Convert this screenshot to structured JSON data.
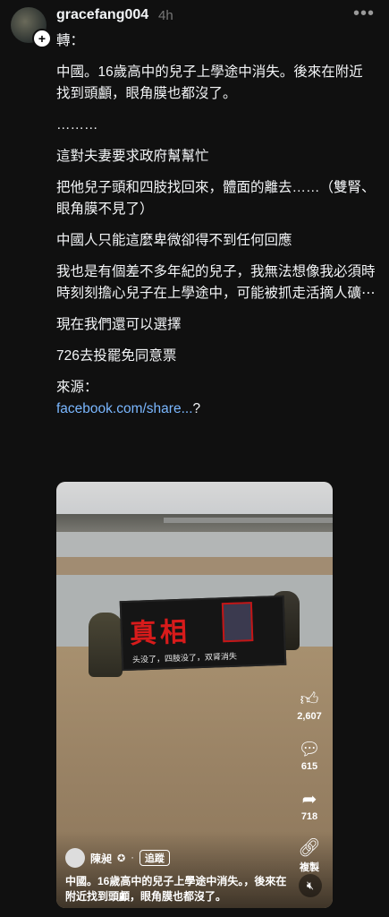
{
  "post": {
    "username": "gracefang004",
    "time": "4h",
    "more_icon": "more-dots-icon",
    "paragraphs": [
      "轉：",
      "中國。16歲高中的兒子上學途中消失。後來在附近找到頭顱，眼角膜也都沒了。",
      "………",
      "這對夫妻要求政府幫幫忙",
      "把他兒子頭和四肢找回來，體面的離去……（雙腎、眼角膜不見了）",
      "中國人只能這麼卑微卻得不到任何回應",
      "我也是有個差不多年紀的兒子，我無法想像我必須時時刻刻擔心兒子在上學途中，可能被抓走活摘人礦⋯",
      "現在我們還可以選擇",
      "726去投罷免同意票",
      "來源："
    ],
    "link_text": "facebook.com/share...",
    "link_suffix": "?"
  },
  "video": {
    "banner_title": "真相",
    "banner_sub": "头没了，四肢没了，双肾消失",
    "actions": [
      {
        "icon": "thumbs-up-icon",
        "label": "2,607"
      },
      {
        "icon": "comment-icon",
        "label": "615"
      },
      {
        "icon": "share-icon",
        "label": "718"
      },
      {
        "icon": "link-icon",
        "label": "複製"
      }
    ],
    "author_name": "陳昶",
    "follow_label": "追蹤",
    "caption": "中國。16歲高中的兒子上學途中消失。，後來在附近找到頭顱，眼角膜也都沒了。",
    "mute_icon": "mute-icon"
  }
}
